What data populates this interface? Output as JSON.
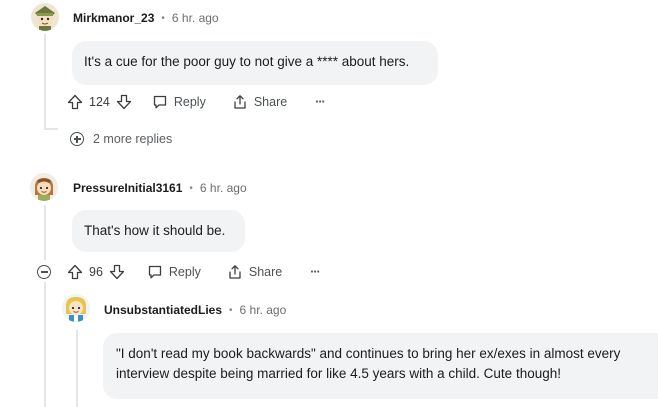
{
  "comments": [
    {
      "username": "Mirkmanor_23",
      "separator": "•",
      "time": "6 hr. ago",
      "body": "It's a cue for the poor guy to not give a **** about hers.",
      "votes": "124",
      "reply_label": "Reply",
      "share_label": "Share",
      "more_label": "···"
    },
    {
      "username": "PressureInitial3161",
      "separator": "•",
      "time": "6 hr. ago",
      "body": "That's how it should be.",
      "votes": "96",
      "reply_label": "Reply",
      "share_label": "Share",
      "more_label": "···"
    },
    {
      "username": "UnsubstantiatedLies",
      "separator": "•",
      "time": "6 hr. ago",
      "body": "\"I don't read my book backwards\" and continues to bring her ex/exes in almost every interview despite being married for like 4.5 years with a child. Cute though!"
    }
  ],
  "more_replies": "2 more replies",
  "icons": {
    "upvote": "upvote-icon",
    "downvote": "downvote-icon",
    "reply": "reply-icon",
    "share": "share-icon",
    "expand": "plus-circle-icon",
    "collapse": "minus-circle-icon"
  },
  "colors": {
    "bubble": "#f1f3f4",
    "thread_line": "#e3e6e8",
    "text": "#1c1c1c",
    "muted": "#6b6e70"
  }
}
